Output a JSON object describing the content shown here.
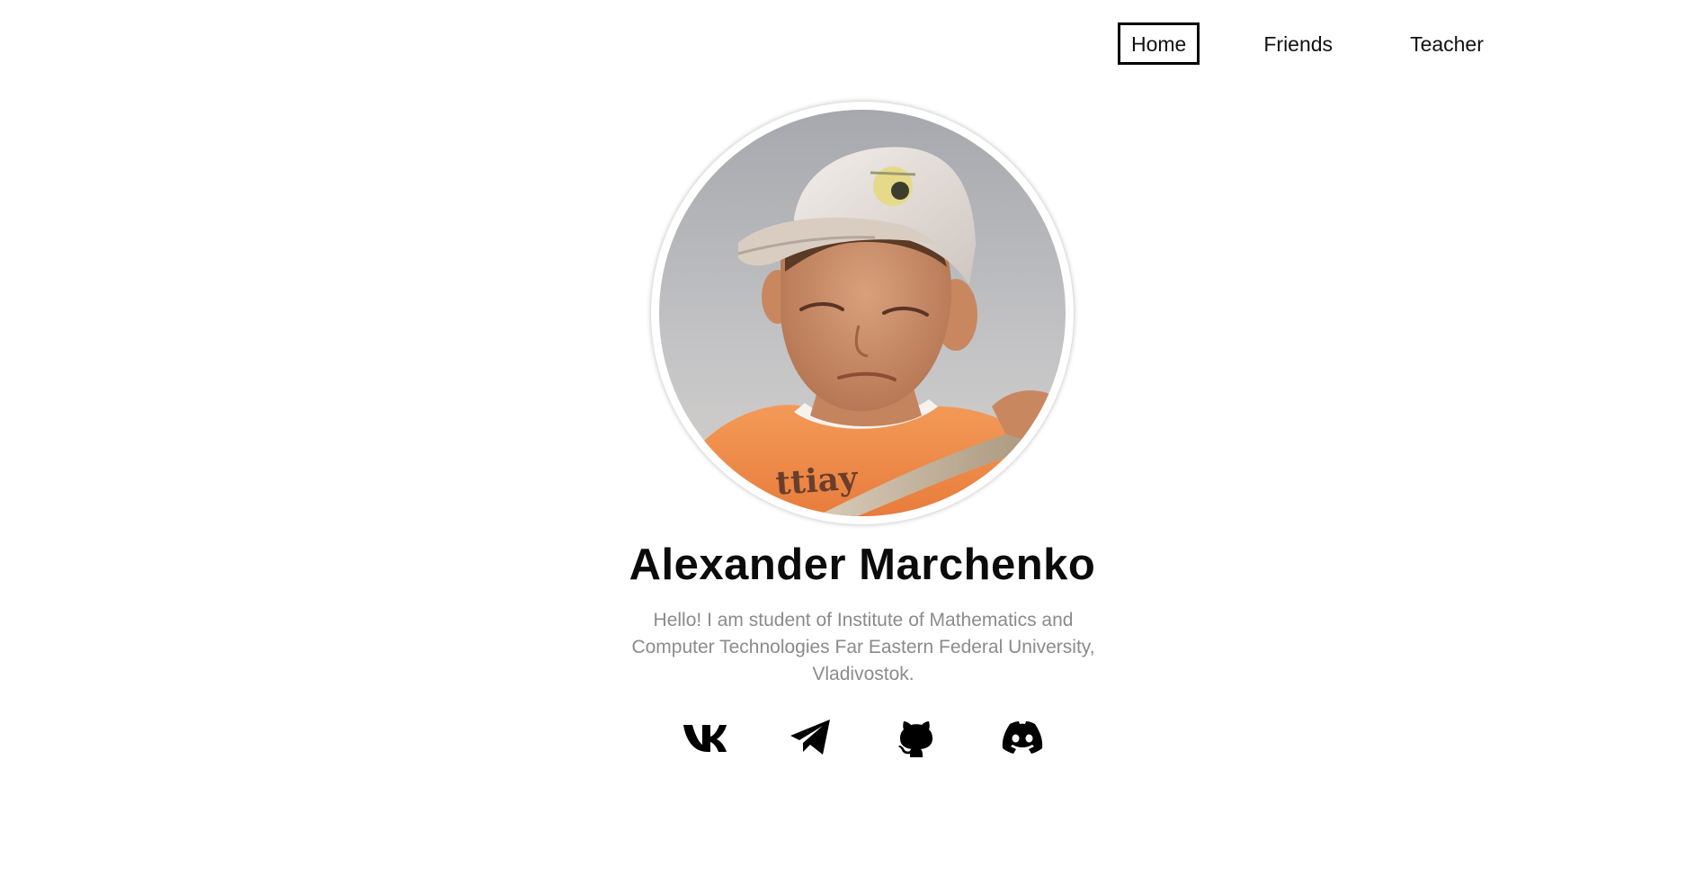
{
  "nav": {
    "items": [
      {
        "label": "Home",
        "active": true
      },
      {
        "label": "Friends",
        "active": false
      },
      {
        "label": "Teacher",
        "active": false
      }
    ]
  },
  "profile": {
    "name": "Alexander Marchenko",
    "bio": "Hello! I am student of Institute of Mathematics and Computer Technologies Far Eastern Federal University, Vladivostok.",
    "shirt_text": "ttiay"
  },
  "social": {
    "icons": [
      "vk-icon",
      "telegram-icon",
      "github-icon",
      "discord-icon"
    ]
  },
  "colors": {
    "text": "#0b0b0b",
    "muted": "#8b8b8b",
    "background": "#ffffff"
  }
}
